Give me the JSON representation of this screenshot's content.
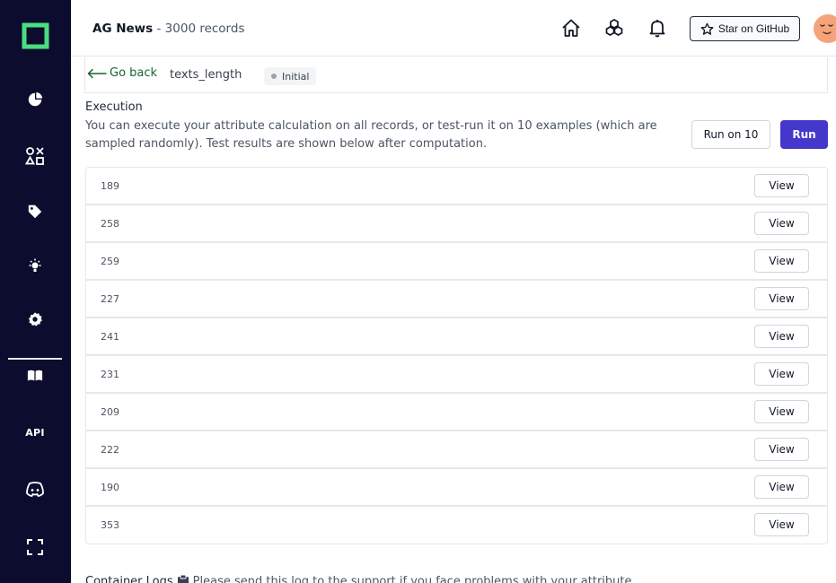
{
  "header": {
    "project_name": "AG News",
    "separator": " - ",
    "record_count": "3000 records",
    "star_label": "Star on GitHub"
  },
  "icons": {
    "logo": "logo-icon",
    "sidebar": [
      "pie-chart-icon",
      "shapes-icon",
      "tag-icon",
      "lightbulb-icon",
      "gear-icon",
      "book-icon",
      "api-icon",
      "discord-icon",
      "fullscreen-icon"
    ],
    "header": [
      "home-icon",
      "hexagons-icon",
      "bell-icon",
      "star-icon"
    ]
  },
  "sidebar": {
    "api_label": "API"
  },
  "subbar": {
    "go_back_label": "Go back",
    "attribute_name": "texts_length",
    "state_label": "Initial"
  },
  "execution": {
    "title": "Execution",
    "description": "You can execute your attribute calculation on all records, or test-run it on 10 examples (which are sampled randomly). Test results are shown below after computation.",
    "run_on_10_label": "Run on 10",
    "run_label": "Run"
  },
  "results": {
    "view_label": "View",
    "rows": [
      {
        "value": "189"
      },
      {
        "value": "258"
      },
      {
        "value": "259"
      },
      {
        "value": "227"
      },
      {
        "value": "241"
      },
      {
        "value": "231"
      },
      {
        "value": "209"
      },
      {
        "value": "222"
      },
      {
        "value": "190"
      },
      {
        "value": "353"
      }
    ]
  },
  "logs": {
    "title": "Container Logs",
    "description": "Please send this log to the support if you face problems with your attribute"
  },
  "colors": {
    "sidebar_bg": "#0c0c2e",
    "logo_green": "#4ade80",
    "run_button": "#4338ca",
    "go_back_text": "#166534",
    "avatar_bg": "#f4a37b"
  }
}
